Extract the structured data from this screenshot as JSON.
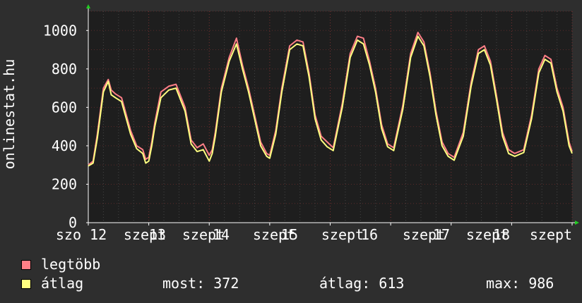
{
  "chart_data": {
    "type": "line",
    "ylabel": "onlinestat.hu",
    "ylim": [
      0,
      1100
    ],
    "yticks": [
      "0",
      "200",
      "400",
      "600",
      "800",
      "1000"
    ],
    "ytick_values": [
      0,
      200,
      400,
      600,
      800,
      1000
    ],
    "xlim": [
      0,
      8
    ],
    "xtick_labels": [
      "szo 12",
      "szept",
      "13",
      "szept",
      "14",
      "szept",
      "15",
      "szept",
      "16",
      "szept",
      "17",
      "szept",
      "18",
      "szept"
    ],
    "x_days": [
      0,
      1,
      2,
      3,
      4,
      5,
      6,
      7,
      8
    ],
    "grid": true,
    "series": [
      {
        "name": "legtöbb",
        "color": "#ff7f87",
        "x": [
          0,
          0.08,
          0.15,
          0.25,
          0.33,
          0.38,
          0.45,
          0.55,
          0.7,
          0.8,
          0.9,
          0.95,
          1.0,
          1.05,
          1.1,
          1.2,
          1.33,
          1.45,
          1.6,
          1.7,
          1.8,
          1.9,
          2.0,
          2.05,
          2.1,
          2.2,
          2.33,
          2.45,
          2.55,
          2.65,
          2.75,
          2.85,
          2.95,
          3.0,
          3.1,
          3.2,
          3.33,
          3.45,
          3.55,
          3.65,
          3.75,
          3.85,
          3.95,
          4.05,
          4.2,
          4.33,
          4.45,
          4.55,
          4.65,
          4.75,
          4.85,
          4.95,
          5.05,
          5.2,
          5.33,
          5.45,
          5.55,
          5.65,
          5.75,
          5.85,
          5.95,
          6.05,
          6.2,
          6.33,
          6.45,
          6.55,
          6.65,
          6.75,
          6.85,
          6.95,
          7.05,
          7.2,
          7.33,
          7.45,
          7.55,
          7.65,
          7.75,
          7.85,
          7.95,
          8.0
        ],
        "values": [
          300,
          320,
          460,
          700,
          745,
          690,
          670,
          650,
          480,
          400,
          380,
          330,
          340,
          420,
          520,
          680,
          710,
          720,
          600,
          430,
          390,
          410,
          350,
          380,
          470,
          700,
          860,
          960,
          820,
          700,
          560,
          420,
          360,
          350,
          480,
          700,
          920,
          950,
          940,
          780,
          560,
          450,
          420,
          390,
          620,
          880,
          970,
          960,
          840,
          700,
          510,
          410,
          390,
          610,
          880,
          990,
          940,
          780,
          580,
          420,
          360,
          340,
          470,
          730,
          900,
          920,
          840,
          660,
          470,
          380,
          360,
          380,
          560,
          800,
          870,
          850,
          700,
          600,
          420,
          370
        ]
      },
      {
        "name": "átlag",
        "color": "#ffff80",
        "x": [
          0,
          0.08,
          0.15,
          0.25,
          0.33,
          0.38,
          0.45,
          0.55,
          0.7,
          0.8,
          0.9,
          0.95,
          1.0,
          1.05,
          1.1,
          1.2,
          1.33,
          1.45,
          1.6,
          1.7,
          1.8,
          1.9,
          2.0,
          2.05,
          2.1,
          2.2,
          2.33,
          2.45,
          2.55,
          2.65,
          2.75,
          2.85,
          2.95,
          3.0,
          3.1,
          3.2,
          3.33,
          3.45,
          3.55,
          3.65,
          3.75,
          3.85,
          3.95,
          4.05,
          4.2,
          4.33,
          4.45,
          4.55,
          4.65,
          4.75,
          4.85,
          4.95,
          5.05,
          5.2,
          5.33,
          5.45,
          5.55,
          5.65,
          5.75,
          5.85,
          5.95,
          6.05,
          6.2,
          6.33,
          6.45,
          6.55,
          6.65,
          6.75,
          6.85,
          6.95,
          7.05,
          7.2,
          7.33,
          7.45,
          7.55,
          7.65,
          7.75,
          7.85,
          7.95,
          8.0
        ],
        "values": [
          295,
          310,
          440,
          680,
          735,
          665,
          650,
          630,
          460,
          385,
          360,
          310,
          320,
          400,
          500,
          650,
          690,
          700,
          580,
          410,
          370,
          380,
          320,
          360,
          450,
          680,
          840,
          930,
          800,
          680,
          540,
          400,
          345,
          335,
          460,
          680,
          900,
          930,
          920,
          760,
          540,
          430,
          395,
          375,
          600,
          860,
          950,
          930,
          820,
          680,
          490,
          395,
          375,
          590,
          860,
          970,
          920,
          760,
          560,
          400,
          345,
          325,
          450,
          710,
          880,
          900,
          820,
          640,
          450,
          360,
          345,
          365,
          540,
          780,
          850,
          830,
          680,
          580,
          400,
          360
        ]
      }
    ]
  },
  "legend": {
    "items": [
      {
        "label": "legtöbb",
        "color": "#ff7f87"
      },
      {
        "label": "átlag",
        "color": "#ffff80"
      }
    ],
    "stats": {
      "most": "most: 372",
      "atlag": "átlag: 613",
      "max": "max: 986"
    }
  }
}
